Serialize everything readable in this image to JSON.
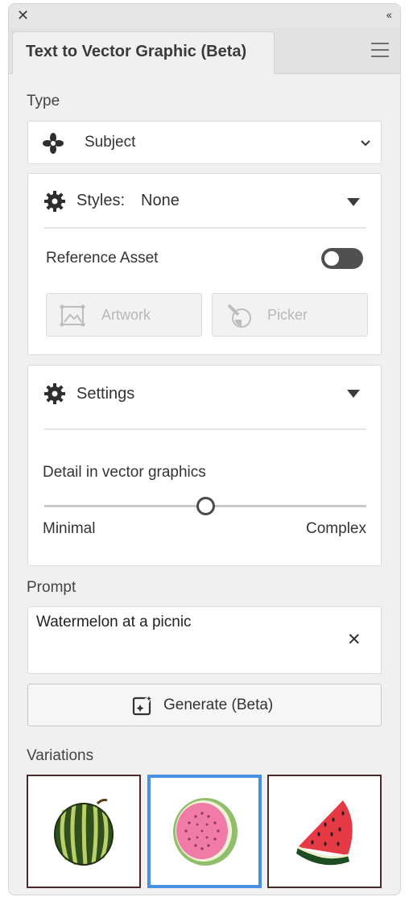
{
  "panel": {
    "close_glyph": "✕",
    "collapse_glyph": "‹‹",
    "tab_title": "Text to Vector Graphic (Beta)"
  },
  "type": {
    "label": "Type",
    "selected": "Subject",
    "icon": "subject-icon"
  },
  "styles": {
    "label": "Styles:",
    "value": "None",
    "reference_asset_label": "Reference Asset",
    "reference_asset_enabled": false,
    "artwork_label": "Artwork",
    "picker_label": "Picker"
  },
  "settings": {
    "label": "Settings",
    "detail_label": "Detail in vector graphics",
    "min_label": "Minimal",
    "max_label": "Complex",
    "detail_level": 0.5
  },
  "prompt": {
    "label": "Prompt",
    "value": "Watermelon at a picnic",
    "clear_glyph": "✕"
  },
  "generate": {
    "label": "Generate (Beta)"
  },
  "variations": {
    "label": "Variations",
    "items": [
      {
        "name": "whole-watermelon",
        "selected": false,
        "border_color": "#4a2a2a"
      },
      {
        "name": "watermelon-slice-round",
        "selected": true,
        "border_color": "#4a90e2"
      },
      {
        "name": "watermelon-wedge",
        "selected": false,
        "border_color": "#4a2a2a"
      }
    ]
  },
  "colors": {
    "accent": "#4a90e2",
    "panel_bg": "#f0f0f0"
  }
}
